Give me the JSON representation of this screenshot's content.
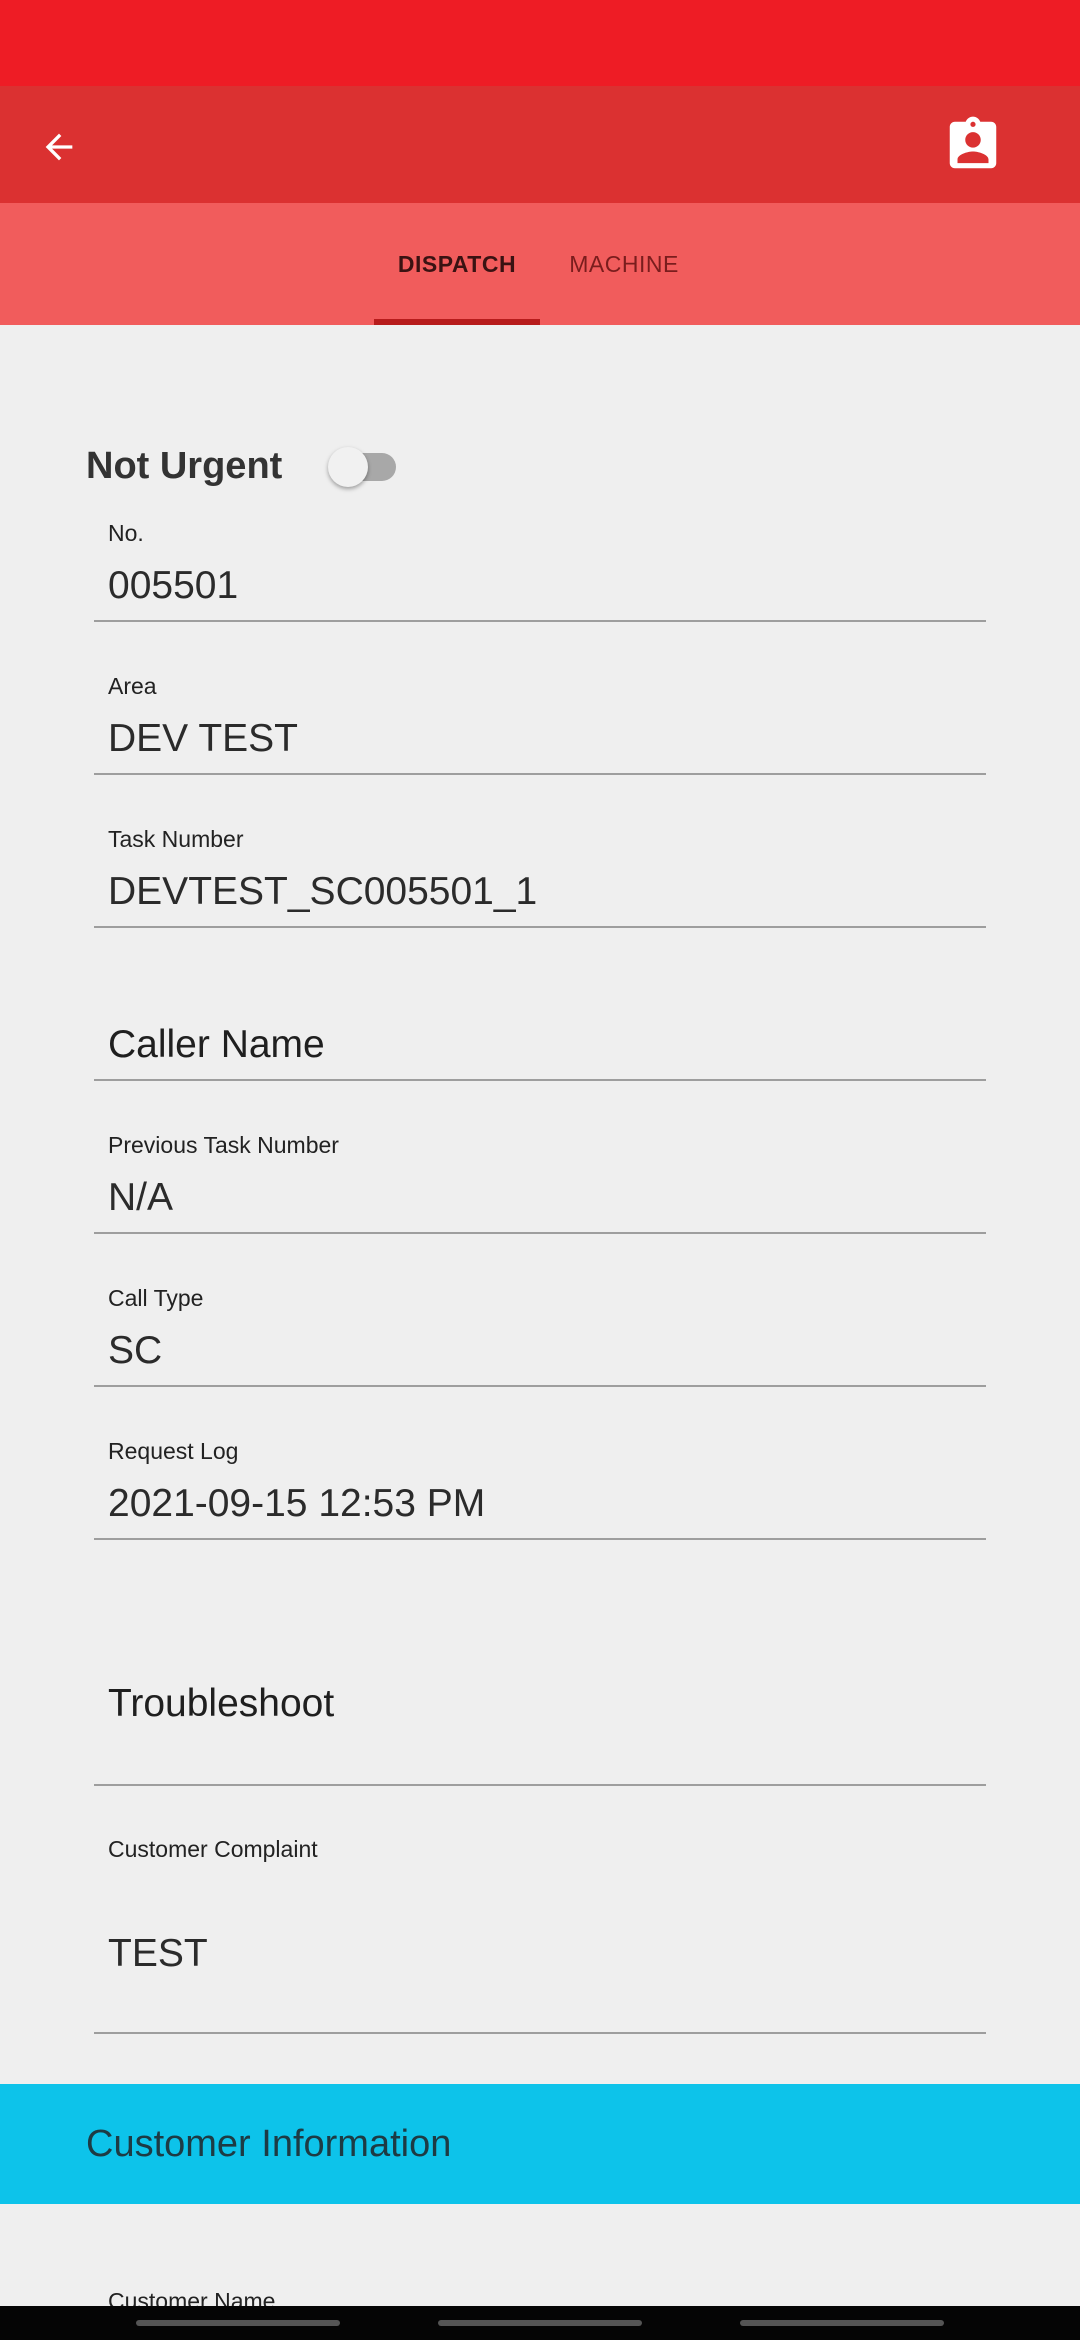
{
  "theme": {
    "status_bar_color": "#ee1c25",
    "app_bar_color": "#db3131",
    "tab_bar_color": "#f15c5c",
    "section_header_color": "#0dc3ea"
  },
  "app_bar": {
    "back_icon": "arrow-left-icon",
    "action_icon": "assignment-ind-icon"
  },
  "tabs": [
    {
      "label": "DISPATCH",
      "selected": true
    },
    {
      "label": "MACHINE",
      "selected": false
    }
  ],
  "urgent": {
    "label": "Not Urgent",
    "switch_on": false
  },
  "fields": {
    "no": {
      "label": "No.",
      "value": "005501"
    },
    "area": {
      "label": "Area",
      "value": "DEV TEST"
    },
    "task_number": {
      "label": "Task Number",
      "value": "DEVTEST_SC005501_1"
    },
    "caller_name": {
      "placeholder": "Caller Name"
    },
    "previous_task_number": {
      "label": "Previous Task Number",
      "value": "N/A"
    },
    "call_type": {
      "label": "Call Type",
      "value": "SC"
    },
    "request_log": {
      "label": "Request Log",
      "value": "2021-09-15 12:53 PM"
    },
    "troubleshoot": {
      "placeholder": "Troubleshoot"
    },
    "customer_complaint": {
      "label": "Customer Complaint",
      "value": "TEST"
    }
  },
  "customer_section": {
    "title": "Customer Information",
    "customer_name_label": "Customer Name"
  }
}
